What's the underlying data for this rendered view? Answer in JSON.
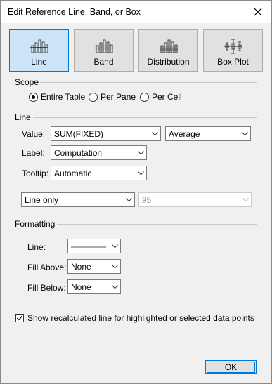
{
  "window": {
    "title": "Edit Reference Line, Band, or Box"
  },
  "types": [
    {
      "label": "Line",
      "icon": "line-chart-icon",
      "selected": true
    },
    {
      "label": "Band",
      "icon": "band-chart-icon",
      "selected": false
    },
    {
      "label": "Distribution",
      "icon": "distribution-chart-icon",
      "selected": false
    },
    {
      "label": "Box Plot",
      "icon": "box-plot-icon",
      "selected": false
    }
  ],
  "scope": {
    "heading": "Scope",
    "options": [
      {
        "label": "Entire Table",
        "selected": true
      },
      {
        "label": "Per Pane",
        "selected": false
      },
      {
        "label": "Per Cell",
        "selected": false
      }
    ]
  },
  "line": {
    "heading": "Line",
    "value_label": "Value:",
    "value_field": "SUM(FIXED)",
    "aggregation": "Average",
    "label_label": "Label:",
    "label_value": "Computation",
    "tooltip_label": "Tooltip:",
    "tooltip_value": "Automatic",
    "interval": "Line only",
    "confidence": "95"
  },
  "formatting": {
    "heading": "Formatting",
    "line_label": "Line:",
    "fill_above_label": "Fill Above:",
    "fill_above_value": "None",
    "fill_below_label": "Fill Below:",
    "fill_below_value": "None"
  },
  "recalc": {
    "label": "Show recalculated line for highlighted or selected data points",
    "checked": true
  },
  "buttons": {
    "ok": "OK"
  },
  "colors": {
    "accent": "#0078d7",
    "selected_bg": "#cce4f7",
    "dialog_bg": "#f0f0f0"
  }
}
